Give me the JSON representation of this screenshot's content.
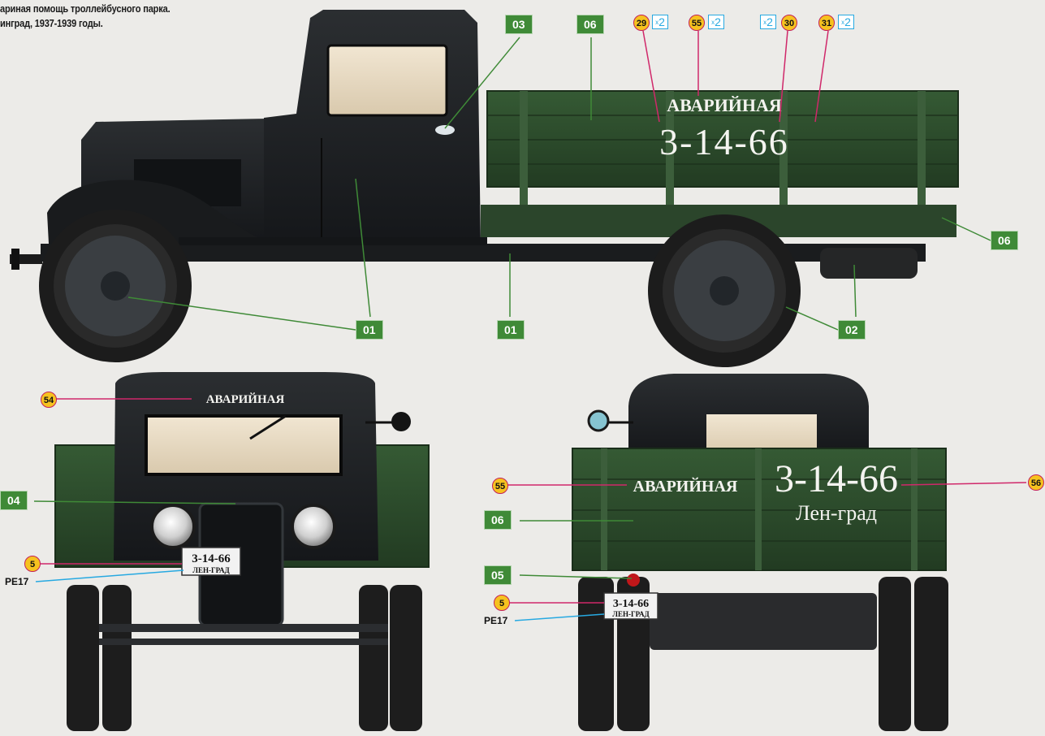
{
  "caption": {
    "line1": "ариная помощь троллейбусного  парка.",
    "line2": "инград, 1937-1939 годы."
  },
  "truck_text": {
    "avariynaya": "АВАРИЙНАЯ",
    "number": "3-14-66",
    "city": "Лен-град",
    "plate_number": "3-14-66",
    "plate_city": "ЛЕН-ГРАД"
  },
  "paint_callouts": {
    "c01a": "01",
    "c01b": "01",
    "c02": "02",
    "c03": "03",
    "c04": "04",
    "c05": "05",
    "c06a": "06",
    "c06b": "06",
    "c06c": "06"
  },
  "decal_callouts": {
    "d29": "29",
    "d55a": "55",
    "d30": "30",
    "d31": "31",
    "d54": "54",
    "d55b": "55",
    "d56": "56",
    "d5a": "5",
    "d5b": "5"
  },
  "multipliers": {
    "m1": "2",
    "m2": "2",
    "m3": "2",
    "m4": "2",
    "prefix": "x"
  },
  "plate_refs": {
    "pe1": "PE17",
    "pe2": "PE17"
  },
  "colors": {
    "cab_black": "#1f2124",
    "body_green": "#2c4a2c",
    "tag_green": "#3f8a37",
    "decal_yellow": "#f6c21f",
    "leader_pink": "#d0286a",
    "leader_blue": "#27a9e1",
    "leader_green": "#3f8a37"
  }
}
